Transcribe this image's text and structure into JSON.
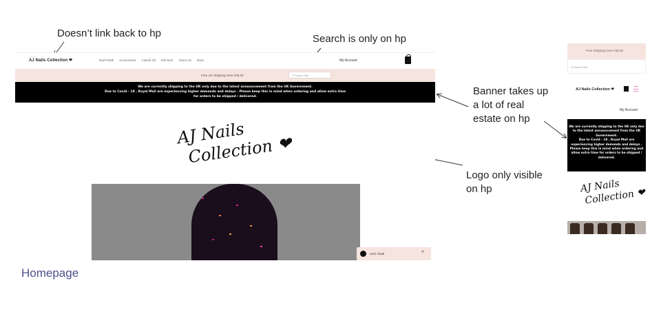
{
  "annotations": {
    "hp_link": "Doesn’t link back to hp",
    "search": "Search is only on hp",
    "banner": [
      "Banner takes up",
      "a lot of real",
      "estate on hp"
    ],
    "logo": [
      "Logo only visible",
      "on hp"
    ]
  },
  "section_label": "Homepage",
  "desktop": {
    "brand": "AJ Nails Collection ❤",
    "menu": [
      "Nail Polish",
      "Accessories",
      "Cuticle Oil",
      "Gift Sets",
      "About Us",
      "More"
    ],
    "account": "My Account",
    "promo": "Free UK Shipping Over £35.00",
    "search_placeholder": "Search Site",
    "banner": [
      "We are currently shipping to the UK only due to the latest announcement from the UK Government.",
      "Due to Covid - 19 , Royal Mail are experiencing higher demands and delays . Please keep this in mind when ordering and allow extra time",
      "for orders to be shipped / delivered."
    ],
    "logo": [
      "AJ Nails",
      "Collection ❤"
    ],
    "chat": "Let's Chat!"
  },
  "mobile": {
    "promo": "Free Shipping Over £35.00",
    "search_placeholder": "Search Site",
    "brand": "AJ Nails Collection ❤",
    "account": "My Account",
    "banner": [
      "We are currently shipping to the UK only due",
      "to the latest announcement from the UK",
      "Government.",
      "Due to Covid - 19 , Royal Mail are",
      "experiencing higher demands and delays .",
      "Please keep this in mind when ordering and",
      "allow extra time for orders to be shipped /",
      "delivered."
    ],
    "logo": [
      "AJ Nails",
      "Collection ❤"
    ]
  }
}
